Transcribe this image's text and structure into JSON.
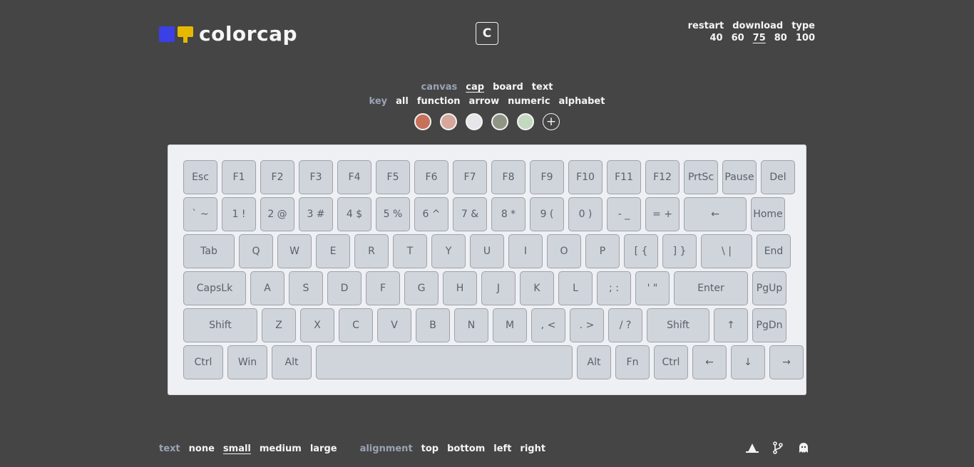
{
  "app": {
    "name": "colorcap",
    "c_button": "C"
  },
  "top_right": {
    "actions": [
      "restart",
      "download",
      "type"
    ],
    "sizes": [
      "40",
      "60",
      "75",
      "80",
      "100"
    ],
    "selected_size": "75"
  },
  "menu1": {
    "label": "canvas",
    "options": [
      "cap",
      "board",
      "text"
    ],
    "selected": "cap"
  },
  "menu2": {
    "label": "key",
    "options": [
      "all",
      "function",
      "arrow",
      "numeric",
      "alphabet"
    ]
  },
  "swatches": [
    "#c7705a",
    "#d6a79b",
    "#e6e6ea",
    "#8f9585",
    "#c3d9bf"
  ],
  "keyboard": {
    "rows": [
      [
        {
          "l": "Esc",
          "w": 48
        },
        {
          "l": "F1",
          "w": 48
        },
        {
          "l": "F2",
          "w": 48
        },
        {
          "l": "F3",
          "w": 48
        },
        {
          "l": "F4",
          "w": 48
        },
        {
          "l": "F5",
          "w": 48
        },
        {
          "l": "F6",
          "w": 48
        },
        {
          "l": "F7",
          "w": 48
        },
        {
          "l": "F8",
          "w": 48
        },
        {
          "l": "F9",
          "w": 48
        },
        {
          "l": "F10",
          "w": 48
        },
        {
          "l": "F11",
          "w": 48
        },
        {
          "l": "F12",
          "w": 48
        },
        {
          "l": "PrtSc",
          "w": 48
        },
        {
          "l": "Pause",
          "w": 48
        },
        {
          "l": "Del",
          "w": 48
        }
      ],
      [
        {
          "l": "` ~",
          "w": 48
        },
        {
          "l": "1 !",
          "w": 48
        },
        {
          "l": "2 @",
          "w": 48
        },
        {
          "l": "3 #",
          "w": 48
        },
        {
          "l": "4 $",
          "w": 48
        },
        {
          "l": "5 %",
          "w": 48
        },
        {
          "l": "6 ^",
          "w": 48
        },
        {
          "l": "7 &",
          "w": 48
        },
        {
          "l": "8 *",
          "w": 48
        },
        {
          "l": "9 (",
          "w": 48
        },
        {
          "l": "0 )",
          "w": 48
        },
        {
          "l": "- _",
          "w": 48
        },
        {
          "l": "= +",
          "w": 48
        },
        {
          "l": "←",
          "w": 88
        },
        {
          "l": "Home",
          "w": 48
        }
      ],
      [
        {
          "l": "Tab",
          "w": 72
        },
        {
          "l": "Q",
          "w": 48
        },
        {
          "l": "W",
          "w": 48
        },
        {
          "l": "E",
          "w": 48
        },
        {
          "l": "R",
          "w": 48
        },
        {
          "l": "T",
          "w": 48
        },
        {
          "l": "Y",
          "w": 48
        },
        {
          "l": "U",
          "w": 48
        },
        {
          "l": "I",
          "w": 48
        },
        {
          "l": "O",
          "w": 48
        },
        {
          "l": "P",
          "w": 48
        },
        {
          "l": "[ {",
          "w": 48
        },
        {
          "l": "] }",
          "w": 48
        },
        {
          "l": "\\ |",
          "w": 72
        },
        {
          "l": "End",
          "w": 48
        }
      ],
      [
        {
          "l": "CapsLk",
          "w": 88
        },
        {
          "l": "A",
          "w": 48
        },
        {
          "l": "S",
          "w": 48
        },
        {
          "l": "D",
          "w": 48
        },
        {
          "l": "F",
          "w": 48
        },
        {
          "l": "G",
          "w": 48
        },
        {
          "l": "H",
          "w": 48
        },
        {
          "l": "J",
          "w": 48
        },
        {
          "l": "K",
          "w": 48
        },
        {
          "l": "L",
          "w": 48
        },
        {
          "l": "; :",
          "w": 48
        },
        {
          "l": "' \"",
          "w": 48
        },
        {
          "l": "Enter",
          "w": 104
        },
        {
          "l": "PgUp",
          "w": 48
        }
      ],
      [
        {
          "l": "Shift",
          "w": 104
        },
        {
          "l": "Z",
          "w": 48
        },
        {
          "l": "X",
          "w": 48
        },
        {
          "l": "C",
          "w": 48
        },
        {
          "l": "V",
          "w": 48
        },
        {
          "l": "B",
          "w": 48
        },
        {
          "l": "N",
          "w": 48
        },
        {
          "l": "M",
          "w": 48
        },
        {
          "l": ", <",
          "w": 48
        },
        {
          "l": ". >",
          "w": 48
        },
        {
          "l": "/ ?",
          "w": 48
        },
        {
          "l": "Shift",
          "w": 88
        },
        {
          "l": "↑",
          "w": 48
        },
        {
          "l": "PgDn",
          "w": 48
        }
      ],
      [
        {
          "l": "Ctrl",
          "w": 56
        },
        {
          "l": "Win",
          "w": 56
        },
        {
          "l": "Alt",
          "w": 56
        },
        {
          "l": "",
          "w": 360
        },
        {
          "l": "Alt",
          "w": 48
        },
        {
          "l": "Fn",
          "w": 48
        },
        {
          "l": "Ctrl",
          "w": 48
        },
        {
          "l": "←",
          "w": 48
        },
        {
          "l": "↓",
          "w": 48
        },
        {
          "l": "→",
          "w": 48
        }
      ]
    ]
  },
  "bottom": {
    "text_label": "text",
    "text_options": [
      "none",
      "small",
      "medium",
      "large"
    ],
    "text_selected": "small",
    "alignment_label": "alignment",
    "alignment_options": [
      "top",
      "bottom",
      "left",
      "right"
    ]
  },
  "icons": [
    "theme-icon",
    "git-branch-icon",
    "ghost-icon"
  ]
}
